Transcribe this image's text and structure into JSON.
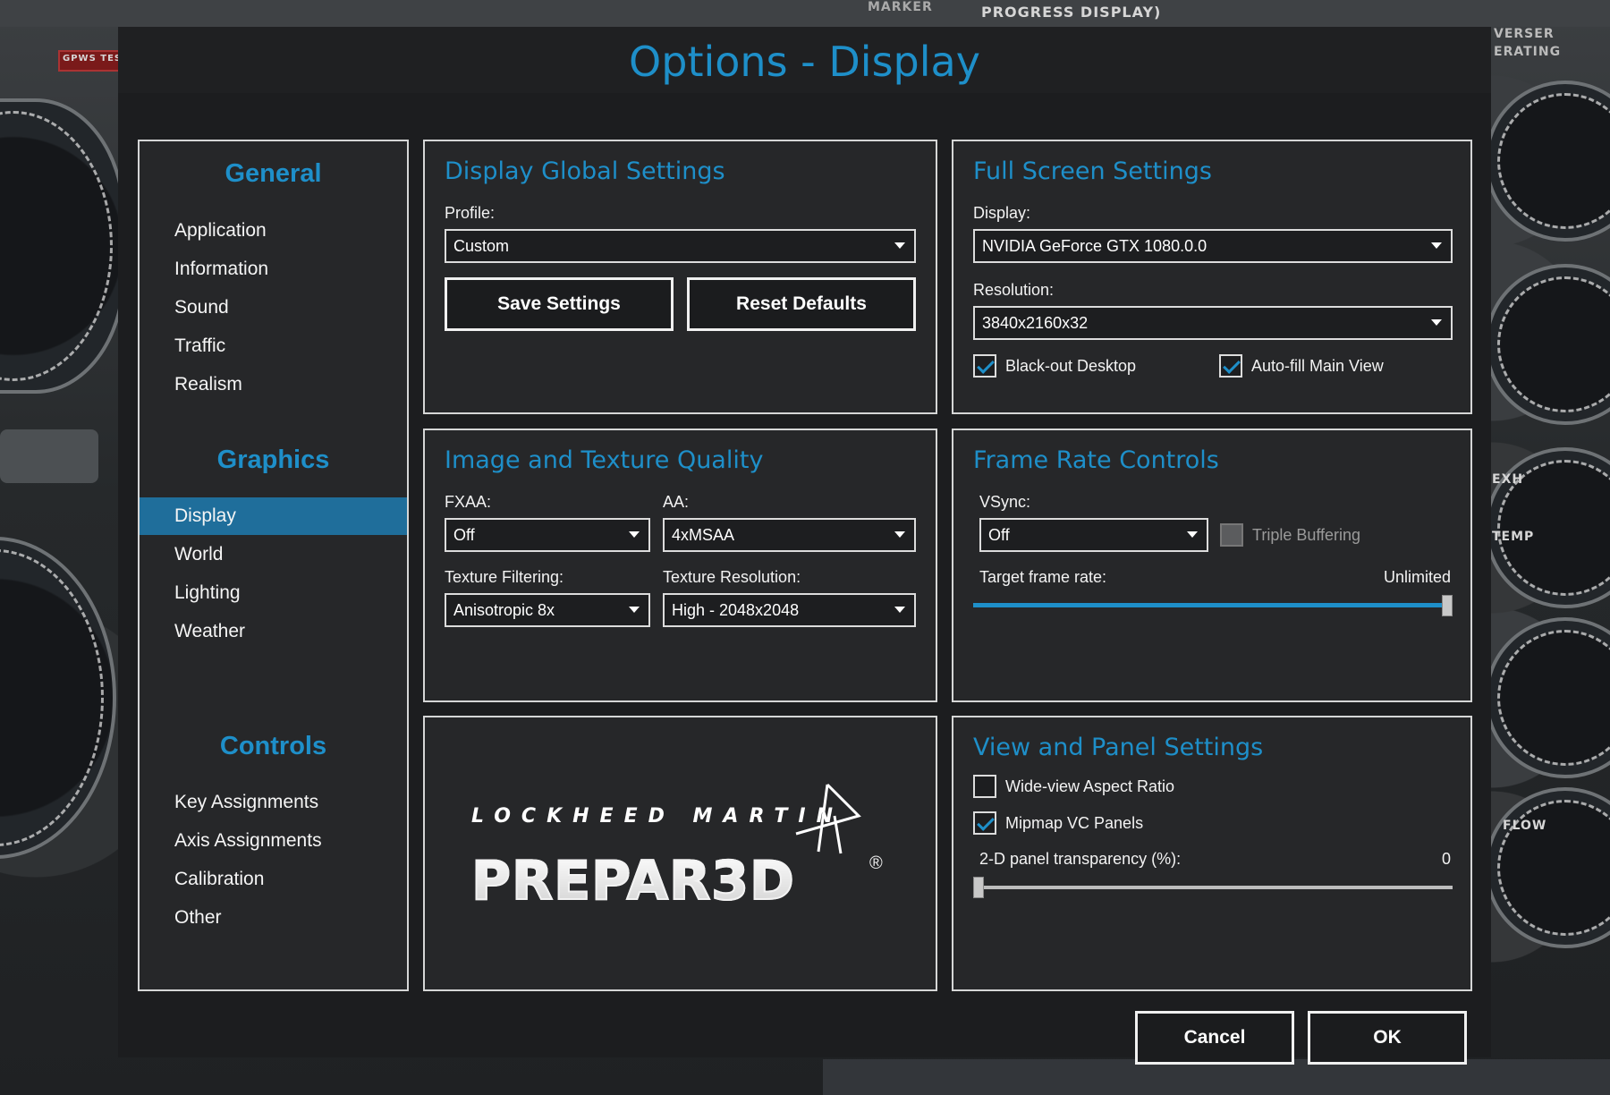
{
  "dialog": {
    "title": "Options - Display"
  },
  "background": {
    "labels": [
      "PROGRESS DISPLAY)",
      "MARKER",
      "GPWS TEST",
      "VERSER",
      "ERATING",
      "FLOW",
      "EXH",
      "TEMP"
    ]
  },
  "sidebar": {
    "sections": [
      {
        "heading": "General",
        "items": [
          "Application",
          "Information",
          "Sound",
          "Traffic",
          "Realism"
        ]
      },
      {
        "heading": "Graphics",
        "items": [
          "Display",
          "World",
          "Lighting",
          "Weather"
        ]
      },
      {
        "heading": "Controls",
        "items": [
          "Key Assignments",
          "Axis Assignments",
          "Calibration",
          "Other"
        ]
      }
    ],
    "active_item": "Display"
  },
  "global": {
    "title": "Display Global Settings",
    "profile_label": "Profile:",
    "profile_value": "Custom",
    "save_label": "Save Settings",
    "reset_label": "Reset Defaults"
  },
  "fullscreen": {
    "title": "Full Screen Settings",
    "display_label": "Display:",
    "display_value": "NVIDIA GeForce GTX 1080.0.0",
    "resolution_label": "Resolution:",
    "resolution_value": "3840x2160x32",
    "blackout_label": "Black-out Desktop",
    "blackout_checked": true,
    "autofill_label": "Auto-fill Main View",
    "autofill_checked": true
  },
  "image": {
    "title": "Image and Texture Quality",
    "fxaa_label": "FXAA:",
    "fxaa_value": "Off",
    "aa_label": "AA:",
    "aa_value": "4xMSAA",
    "filtering_label": "Texture Filtering:",
    "filtering_value": "Anisotropic 8x",
    "resolution_label": "Texture Resolution:",
    "resolution_value": "High - 2048x2048"
  },
  "framerate": {
    "title": "Frame Rate Controls",
    "vsync_label": "VSync:",
    "vsync_value": "Off",
    "triple_label": "Triple Buffering",
    "triple_checked": false,
    "target_label": "Target frame rate:",
    "target_value": "Unlimited",
    "target_fraction": 1.0
  },
  "logo": {
    "company": "LOCKHEED MARTIN",
    "product": "PREPAR3D",
    "reg": "®"
  },
  "view": {
    "title": "View and Panel Settings",
    "wide_label": "Wide-view Aspect Ratio",
    "wide_checked": false,
    "mipmap_label": "Mipmap VC Panels",
    "mipmap_checked": true,
    "transparency_label": "2-D panel transparency (%):",
    "transparency_value": "0",
    "transparency_fraction": 0.0
  },
  "footer": {
    "cancel_label": "Cancel",
    "ok_label": "OK"
  },
  "colors": {
    "accent": "#1e8fc9",
    "active_item": "#1f6e9b",
    "panel_border": "#d5d6d6"
  }
}
